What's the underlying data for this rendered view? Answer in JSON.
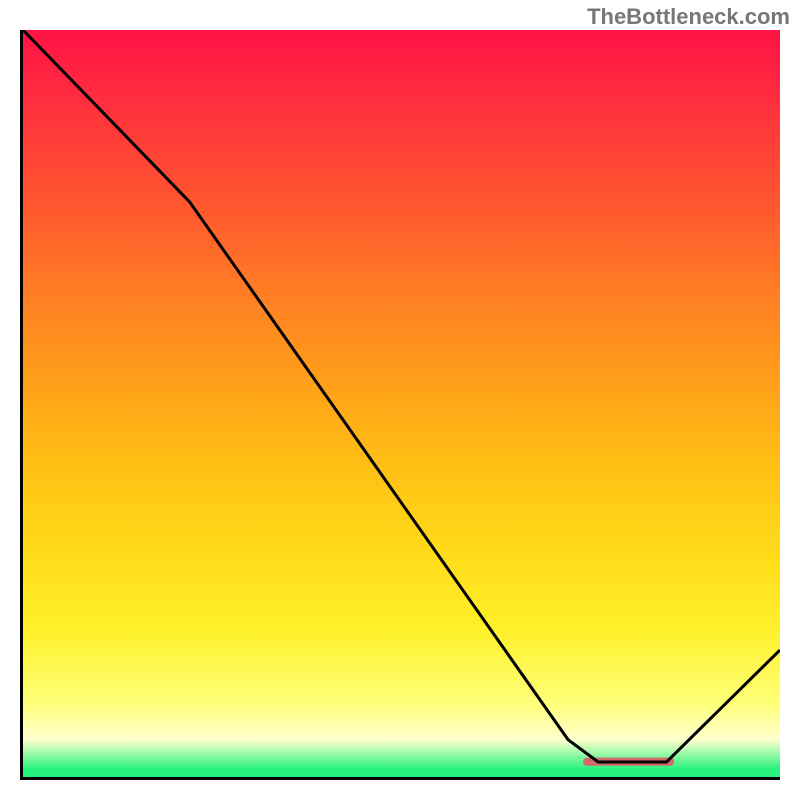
{
  "attribution": "TheBottleneck.com",
  "chart_data": {
    "type": "line",
    "title": "",
    "xlabel": "",
    "ylabel": "",
    "xlim": [
      0,
      100
    ],
    "ylim": [
      0,
      100
    ],
    "grid": false,
    "series": [
      {
        "name": "curve",
        "x": [
          0,
          22,
          72,
          76,
          85,
          100
        ],
        "y": [
          100,
          77,
          5,
          2,
          2,
          17
        ],
        "color": "#000000"
      }
    ],
    "marker": {
      "name": "optimal-range",
      "x_start": 74,
      "x_end": 86,
      "y": 2,
      "color": "#d06a6a"
    },
    "background_gradient": {
      "top": "#ff1245",
      "mid1": "#ffb317",
      "mid2": "#ffff78",
      "bottom": "#26f37d"
    }
  }
}
